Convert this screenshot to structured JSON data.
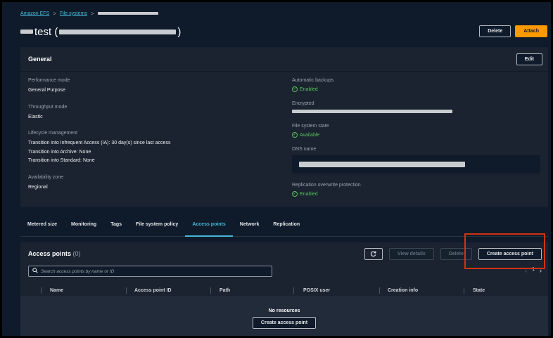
{
  "breadcrumb": {
    "items": [
      "Amazon EFS",
      "File systems"
    ],
    "separator": ">"
  },
  "page": {
    "title_visible": "test (",
    "title_close": ")"
  },
  "header_actions": {
    "delete_label": "Delete",
    "attach_label": "Attach"
  },
  "general": {
    "title": "General",
    "edit_label": "Edit",
    "left": {
      "performance_mode_label": "Performance mode",
      "performance_mode_value": "General Purpose",
      "throughput_mode_label": "Throughput mode",
      "throughput_mode_value": "Elastic",
      "lifecycle_label": "Lifecycle management",
      "lifecycle_ia": "Transition into Infrequent Access (IA): 30 day(s) since last access",
      "lifecycle_archive": "Transition into Archive: None",
      "lifecycle_standard": "Transition into Standard: None",
      "availability_label": "Availability zone",
      "availability_value": "Regional"
    },
    "right": {
      "backups_label": "Automatic backups",
      "backups_value": "Enabled",
      "encrypted_label": "Encrypted",
      "state_label": "File system state",
      "state_value": "Available",
      "dns_label": "DNS name",
      "replication_label": "Replication overwrite protection",
      "replication_value": "Enabled"
    }
  },
  "tabs": [
    {
      "label": "Metered size"
    },
    {
      "label": "Monitoring"
    },
    {
      "label": "Tags"
    },
    {
      "label": "File system policy"
    },
    {
      "label": "Access points"
    },
    {
      "label": "Network"
    },
    {
      "label": "Replication"
    }
  ],
  "active_tab": "Access points",
  "access_points": {
    "title": "Access points",
    "count": "(0)",
    "refresh_icon": "refresh-icon",
    "view_details_label": "View details",
    "delete_label": "Delete",
    "create_label": "Create access point",
    "search_placeholder": "Search access points by name or ID",
    "pager_current": "1",
    "columns": [
      "Name",
      "Access point ID",
      "Path",
      "POSIX user",
      "Creation info",
      "State"
    ],
    "empty_title": "No resources",
    "empty_create_label": "Create access point"
  },
  "colors": {
    "background": "#0f1b2a",
    "card": "#1b2330",
    "link": "#44b9d6",
    "primary": "#ff9900",
    "success": "#57c35a",
    "highlight": "#d13212"
  }
}
